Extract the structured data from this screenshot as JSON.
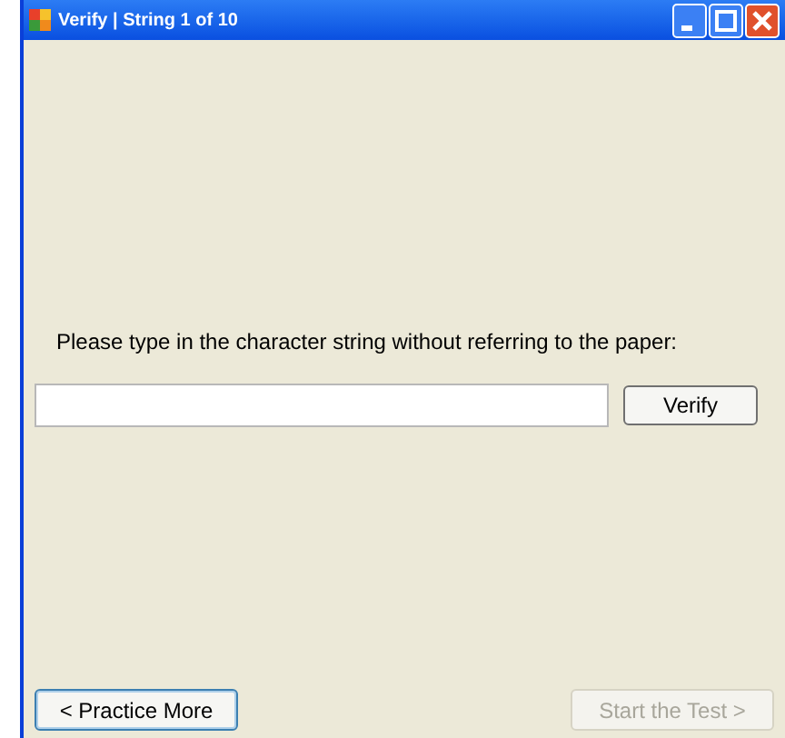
{
  "window": {
    "title": "Verify | String 1 of 10"
  },
  "prompt": "Please type in the character string without referring to the paper:",
  "buttons": [
    {
      "label": "Verify",
      "disabled": false
    },
    {
      "label": "< Practice More",
      "disabled": false,
      "selected": true
    },
    {
      "label": "Start the Test >",
      "disabled": true,
      "selected": false
    }
  ]
}
